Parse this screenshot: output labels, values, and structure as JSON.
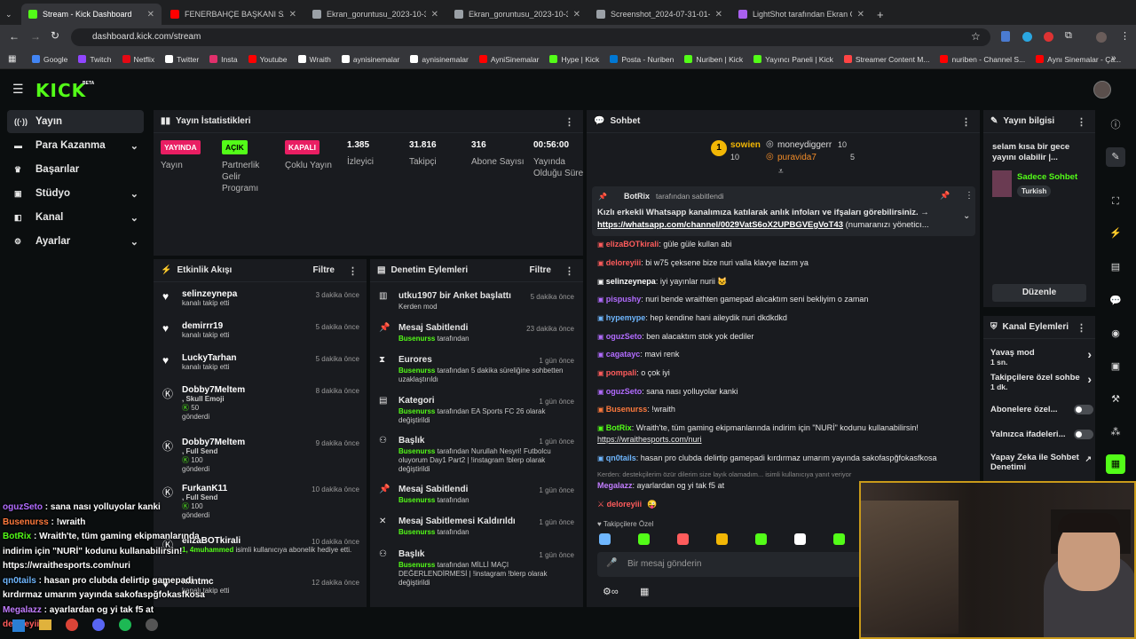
{
  "browser": {
    "tabs": [
      {
        "title": "Stream - Kick Dashboard",
        "color": "#53fc18",
        "active": true
      },
      {
        "title": "FENERBAHÇE BAŞKANI SADETT",
        "color": "#ff0000"
      },
      {
        "title": "Ekran_goruntusu_2023-10-31_",
        "color": "#9aa0a6"
      },
      {
        "title": "Ekran_goruntusu_2023-10-31_",
        "color": "#9aa0a6"
      },
      {
        "title": "Screenshot_2024-07-31-01-34",
        "color": "#9aa0a6"
      },
      {
        "title": "LightShot tarafından Ekran Gö",
        "color": "#a960ee"
      }
    ],
    "url": "dashboard.kick.com/stream",
    "bookmarks": [
      {
        "label": "Google",
        "color": "#4285f4"
      },
      {
        "label": "Twitch",
        "color": "#9146ff"
      },
      {
        "label": "Netflix",
        "color": "#e50914"
      },
      {
        "label": "Twitter",
        "color": "#ffffff"
      },
      {
        "label": "Insta",
        "color": "#e1306c"
      },
      {
        "label": "Youtube",
        "color": "#ff0000"
      },
      {
        "label": "Wraith",
        "color": "#ffffff"
      },
      {
        "label": "aynisinemalar",
        "color": "#ffffff"
      },
      {
        "label": "aynisinemalar",
        "color": "#ffffff"
      },
      {
        "label": "AyniSinemalar",
        "color": "#ff0000"
      },
      {
        "label": "Hype | Kick",
        "color": "#53fc18"
      },
      {
        "label": "Posta - Nuriben",
        "color": "#0078d4"
      },
      {
        "label": "Nuriben | Kick",
        "color": "#53fc18"
      },
      {
        "label": "Yayıncı Paneli | Kick",
        "color": "#53fc18"
      },
      {
        "label": "Streamer Content M...",
        "color": "#ff4444"
      },
      {
        "label": "nuriben - Channel S...",
        "color": "#ff0000"
      },
      {
        "label": "Aynı Sinemalar - Ça...",
        "color": "#ff0000"
      }
    ]
  },
  "logo": "KICK",
  "logo_tag": "BETA",
  "sidebar": {
    "items": [
      {
        "label": "Yayın",
        "icon": "broadcast-icon",
        "glyph": "((·))",
        "chev": false,
        "active": true
      },
      {
        "label": "Para Kazanma",
        "icon": "money-icon",
        "glyph": "▬",
        "chev": true
      },
      {
        "label": "Başarılar",
        "icon": "trophy-icon",
        "glyph": "♛",
        "chev": false
      },
      {
        "label": "Stüdyo",
        "icon": "studio-icon",
        "glyph": "▣",
        "chev": true
      },
      {
        "label": "Kanal",
        "icon": "channel-icon",
        "glyph": "◧",
        "chev": true
      },
      {
        "label": "Ayarlar",
        "icon": "settings-icon",
        "glyph": "⚙",
        "chev": true
      }
    ]
  },
  "stats": {
    "title": "Yayın İstatistikleri",
    "items": [
      {
        "badge": "YAYINDA",
        "badge_color": "#e91e63",
        "badge_text_color": "#ffffff",
        "label": "Yayın"
      },
      {
        "badge": "AÇIK",
        "badge_color": "#53fc18",
        "badge_text_color": "#000000",
        "label": "Partnerlik Gelir Programı"
      },
      {
        "badge": "KAPALI",
        "badge_color": "#e91e63",
        "badge_text_color": "#ffffff",
        "label": "Çoklu Yayın"
      },
      {
        "value": "1.385",
        "label": "İzleyici"
      },
      {
        "value": "31.816",
        "label": "Takipçi"
      },
      {
        "value": "316",
        "label": "Abone Sayısı"
      },
      {
        "value": "00:56:00",
        "label": "Yayında Olduğu Süre"
      }
    ]
  },
  "activity": {
    "title": "Etkinlik Akışı",
    "filter": "Filtre",
    "rows": [
      {
        "name": "selinzeynepa",
        "time": "3 dakika önce",
        "sub": "kanalı takip etti"
      },
      {
        "name": "demirrr19",
        "time": "5 dakika önce",
        "sub": "kanalı takip etti"
      },
      {
        "name": "LuckyTarhan",
        "time": "5 dakika önce",
        "sub": "kanalı takip etti"
      },
      {
        "name": "Dobby7Meltem",
        "time": "8 dakika önce",
        "emote": ", Skull Emoji",
        "amount": "50",
        "sub": "gönderdi"
      },
      {
        "name": "Dobby7Meltem",
        "time": "9 dakika önce",
        "emote": ", Full Send",
        "amount": "100",
        "sub": "gönderdi"
      },
      {
        "name": "FurkanK11",
        "time": "10 dakika önce",
        "emote": ", Full Send",
        "amount": "100",
        "sub": "gönderdi"
      },
      {
        "name": "elizaBOTkirali",
        "time": "10 dakika önce",
        "gifted": "1, 4muhammed",
        "sub": "isimli kullanıcıya abonelik hediye etti."
      },
      {
        "name": "nkntmc",
        "time": "12 dakika önce",
        "sub": "kanalı takip etti"
      }
    ]
  },
  "moderation": {
    "title": "Denetim Eylemleri",
    "filter": "Filtre",
    "rows": [
      {
        "title": "utku1907 bir Anket başlattı",
        "time": "5 dakika önce",
        "who": "",
        "desc": "Kerden mod",
        "icon": "poll-icon",
        "glyph": "▥"
      },
      {
        "title": "Mesaj Sabitlendi",
        "time": "23 dakika önce",
        "who": "Busenurss",
        "desc": "tarafından",
        "icon": "pin-icon",
        "glyph": "📌"
      },
      {
        "title": "Eurores",
        "time": "1 gün önce",
        "who": "Busenurss",
        "desc": "tarafından 5 dakika süreliğine sohbetten uzaklaştırıldı",
        "icon": "hourglass-icon",
        "glyph": "⧗"
      },
      {
        "title": "Kategori",
        "time": "1 gün önce",
        "who": "Busenurss",
        "desc": "tarafından EA Sports FC 26 olarak değiştirildi",
        "icon": "category-icon",
        "glyph": "▤"
      },
      {
        "title": "Başlık",
        "time": "1 gün önce",
        "who": "Busenurss",
        "desc": "tarafından Nurullah Nesyri! Futbolcu oluyorum Day1 Part2 | !instagram !blerp olarak değiştirildi",
        "icon": "title-icon",
        "glyph": "⚇"
      },
      {
        "title": "Mesaj Sabitlendi",
        "time": "1 gün önce",
        "who": "Busenurss",
        "desc": "tarafından",
        "icon": "pin-icon",
        "glyph": "📌"
      },
      {
        "title": "Mesaj Sabitlemesi Kaldırıldı",
        "time": "1 gün önce",
        "who": "Busenurss",
        "desc": "tarafından",
        "icon": "unpin-icon",
        "glyph": "✕"
      },
      {
        "title": "Başlık",
        "time": "1 gün önce",
        "who": "Busenurss",
        "desc": "tarafından MİLLİ MAÇI DEĞERLENDİRMESİ | !instagram !blerp olarak değiştirildi",
        "icon": "title-icon",
        "glyph": "⚇"
      }
    ]
  },
  "chat": {
    "title": "Sohbet",
    "leaderboard": {
      "rank1": {
        "name": "sowien",
        "count": "10"
      },
      "rank2": {
        "name": "moneydiggerr",
        "count": "10"
      },
      "rank3": {
        "name": "puravida7",
        "count": "5"
      }
    },
    "pinned": {
      "by": "BotRix",
      "by_suffix": "tarafından sabitlendi",
      "text": "Kızlı erkekli Whatsapp kanalımıza katılarak anlık infoları ve ifşaları görebilirsiniz. →",
      "link": "https://whatsapp.com/channel/0029VatS6oX2UPBGVEgVoT43",
      "tail": "(numaranızı yöneticı..."
    },
    "messages": [
      {
        "user": "elizaBOTkirali",
        "color": "#ff5c5c",
        "text": ": güle güle kullan abi"
      },
      {
        "user": "deloreyiii",
        "color": "#ff5c5c",
        "text": ": bi w75 çeksene bize nuri valla klavye lazım ya"
      },
      {
        "user": "selinzeynepa",
        "color": "#ffffff",
        "text": ": iyi yayınlar nurii 🐱"
      },
      {
        "user": "pispushy",
        "color": "#b26cff",
        "text": ": nuri bende wraithten gamepad alıcaktım seni bekliyim o zaman"
      },
      {
        "user": "hypemype",
        "color": "#6fb7ff",
        "text": ": hep kendine hani aileydik nuri dkdkdkd"
      },
      {
        "user": "oguzSeto",
        "color": "#b26cff",
        "text": ": ben alacaktım stok yok dediler"
      },
      {
        "user": "cagatayc",
        "color": "#b26cff",
        "text": ": mavi renk"
      },
      {
        "user": "pompali",
        "color": "#ff5c5c",
        "text": ": o çok iyi"
      },
      {
        "user": "oguzSeto",
        "color": "#b26cff",
        "text": ": sana nası yolluyolar kanki"
      },
      {
        "user": "Busenurss",
        "color": "#ff7a3d",
        "text": ": !wraith"
      },
      {
        "user": "BotRix",
        "color": "#53fc18",
        "text": ": Wraith'te, tüm gaming ekipmanlarında indirim için \"NURİ\" kodunu kullanabilirsin!"
      },
      {
        "user": "",
        "color": "#ffffff",
        "text": "https://wraithesports.com/nuri"
      },
      {
        "user": "qn0tails",
        "color": "#6fb7ff",
        "text": ": hasan pro clubda delirtip gamepadi kırdırmaz umarım yayında sakofaspğfokasfkosa"
      }
    ],
    "reply_hint": "Kerden: destekçilerim özür dilerim size layık olamadım... isimli kullanıcıya yanıt veriyor",
    "reply_user": "Megalazz",
    "reply_text": ": ayarlardan og yi tak f5 at",
    "last_user": "deloreyiii",
    "followers_only": "Takipçilere Özel",
    "placeholder": "Bir mesaj gönderin"
  },
  "stream_info": {
    "title": "Yayın bilgisi",
    "stream_title": "selam kısa bir gece yayını olabilir |...",
    "category": "Sadece Sohbet",
    "tag": "Turkish",
    "edit": "Düzenle"
  },
  "channel_actions": {
    "title": "Kanal Eylemleri",
    "items": [
      {
        "label": "Yavaş mod",
        "sub": "1 sn.",
        "type": "arrow"
      },
      {
        "label": "Takipçilere özel sohbe",
        "sub": "1 dk.",
        "type": "arrow"
      },
      {
        "label": "Abonelere özel...",
        "type": "toggle"
      },
      {
        "label": "Yalnızca ifadeleri...",
        "type": "toggle"
      },
      {
        "label": "Yapay Zeka ile Sohbet Denetimi",
        "type": "ext"
      }
    ]
  },
  "overlay_chat": [
    {
      "user": "oguzSeto",
      "color": "#b26cff",
      "text": " : sana nası yolluyolar kanki"
    },
    {
      "user": "Busenurss",
      "color": "#ff7a3d",
      "text": " : !wraith"
    },
    {
      "user": "BotRix",
      "color": "#53fc18",
      "text": " : Wraith'te, tüm gaming ekipmanlarında"
    },
    {
      "user": "",
      "color": "#ffffff",
      "text": "indirim için \"NURİ\" kodunu kullanabilirsin!"
    },
    {
      "user": "",
      "color": "#ffffff",
      "text": "https://wraithesports.com/nuri"
    },
    {
      "user": "qn0tails",
      "color": "#6fb7ff",
      "text": " : hasan pro clubda delirtip gamepadi"
    },
    {
      "user": "",
      "color": "#ffffff",
      "text": "kırdırmaz umarım yayında sakofaspğfokasfkosa"
    },
    {
      "user": "Megalazz",
      "color": "#c27dff",
      "text": " : ayarlardan og yi tak f5 at"
    },
    {
      "user": "deloreyiii",
      "color": "#ff5c5c",
      "text": ""
    }
  ]
}
